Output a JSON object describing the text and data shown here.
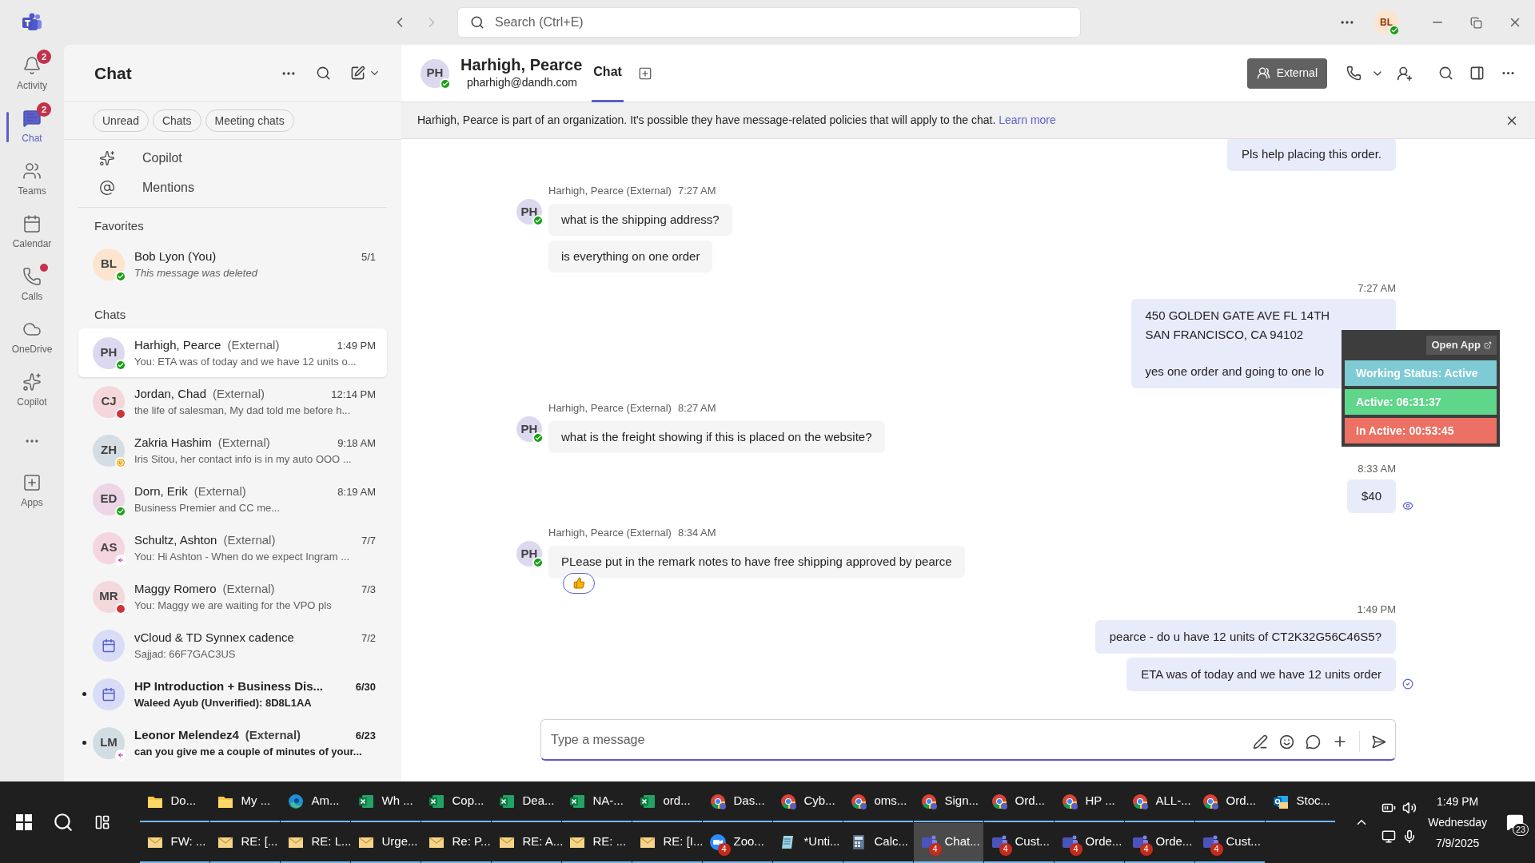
{
  "titlebar": {
    "search_placeholder": "Search (Ctrl+E)",
    "user_initials": "BL",
    "user_presence": {
      "kind": "available"
    }
  },
  "rail": [
    {
      "label": "Activity",
      "badge": "2",
      "alert": false,
      "selected": false
    },
    {
      "label": "Chat",
      "badge": "2",
      "alert": false,
      "selected": true
    },
    {
      "label": "Teams",
      "alert": false,
      "selected": false
    },
    {
      "label": "Calendar",
      "alert": false,
      "selected": false
    },
    {
      "label": "Calls",
      "alert": true,
      "selected": false
    },
    {
      "label": "OneDrive",
      "alert": false,
      "selected": false
    },
    {
      "label": "Copilot",
      "alert": false,
      "selected": false
    }
  ],
  "rail_apps": {
    "label": "Apps"
  },
  "chat_list": {
    "title": "Chat",
    "filters": [
      {
        "label": "Unread",
        "selected": false
      },
      {
        "label": "Chats",
        "selected": false
      },
      {
        "label": "Meeting chats",
        "selected": false
      }
    ],
    "shortcuts": [
      {
        "label": "Copilot"
      },
      {
        "label": "Mentions"
      }
    ],
    "sections": [
      {
        "heading": "Favorites",
        "items": [
          {
            "kind": "person",
            "initials": "BL",
            "color": "#fde4cf",
            "name": "Bob Lyon (You)",
            "time": "5/1",
            "preview": "This message was deleted",
            "deleted": true,
            "presence": {
              "kind": "available"
            },
            "selected": false,
            "unread": false
          }
        ]
      },
      {
        "heading": "Chats",
        "items": [
          {
            "kind": "person",
            "initials": "PH",
            "color": "#dcd8ef",
            "name": "Harhigh, Pearce",
            "tag": "(External)",
            "time": "1:49 PM",
            "preview": "You: ETA was of today and we have 12 units o...",
            "deleted": false,
            "presence": {
              "kind": "available"
            },
            "selected": true,
            "unread": false
          },
          {
            "kind": "person",
            "initials": "CJ",
            "color": "#f4d6db",
            "name": "Jordan, Chad",
            "tag": "(External)",
            "time": "12:14 PM",
            "preview": "the life of salesman, My dad told me before h...",
            "deleted": false,
            "presence": {
              "kind": "busy"
            },
            "selected": false,
            "unread": false
          },
          {
            "kind": "person",
            "initials": "ZH",
            "color": "#d4dde3",
            "name": "Zakria Hashim",
            "tag": "(External)",
            "time": "9:18 AM",
            "preview": "Iris Sitou, her contact info is in my auto OOO ...",
            "deleted": false,
            "presence": {
              "kind": "away"
            },
            "selected": false,
            "unread": false
          },
          {
            "kind": "person",
            "initials": "ED",
            "color": "#ecd5e4",
            "name": "Dorn, Erik",
            "tag": "(External)",
            "time": "8:19 AM",
            "preview": "Business Premier and CC me...",
            "deleted": false,
            "presence": {
              "kind": "available"
            },
            "selected": false,
            "unread": false
          },
          {
            "kind": "person",
            "initials": "AS",
            "color": "#f5d5e0",
            "name": "Schultz, Ashton",
            "tag": "(External)",
            "time": "7/7",
            "preview": "You: Hi Ashton -  When do we expect Ingram ...",
            "deleted": false,
            "presence": {
              "kind": "out"
            },
            "selected": false,
            "unread": false
          },
          {
            "kind": "person",
            "initials": "MR",
            "color": "#f3d8dc",
            "name": "Maggy Romero",
            "tag": "(External)",
            "time": "7/3",
            "preview": "You: Maggy we are waiting for the VPO pls",
            "deleted": false,
            "presence": {
              "kind": "busy"
            },
            "selected": false,
            "unread": false
          },
          {
            "kind": "meeting",
            "color": "#d9dcf7",
            "name": "vCloud & TD Synnex cadence",
            "time": "7/2",
            "preview": "Sajjad: 66F7GAC3US",
            "deleted": false,
            "selected": false,
            "unread": false
          },
          {
            "kind": "meeting",
            "color": "#d9dcf7",
            "name": "HP Introduction + Business Dis...",
            "time": "6/30",
            "preview": "Waleed Ayub (Unverified): 8D8L1AA",
            "deleted": false,
            "selected": false,
            "unread": true
          },
          {
            "kind": "person",
            "initials": "LM",
            "color": "#d2dde3",
            "name": "Leonor Melendez4",
            "tag": "(External)",
            "time": "6/23",
            "preview": "can you give me a couple of minutes of your...",
            "deleted": false,
            "presence": {
              "kind": "out"
            },
            "selected": false,
            "unread": true
          }
        ]
      }
    ]
  },
  "conversation": {
    "initials": "PH",
    "presence": {
      "kind": "available"
    },
    "name": "Harhigh, Pearce",
    "email": "pharhigh@dandh.com",
    "tabs": [
      {
        "label": "Chat",
        "selected": true
      }
    ],
    "external_button": "External",
    "banner": {
      "text": "Harhigh, Pearce is part of an organization. It's possible they have message-related policies that will apply to the chat.",
      "link": "Learn more"
    },
    "messages": [
      {
        "kind": "outgoing",
        "bubbles": [
          [
            [
              "Pls help placing this order."
            ]
          ]
        ]
      },
      {
        "kind": "incoming",
        "initials": "PH",
        "presence": {
          "kind": "available"
        },
        "sender": "Harhigh, Pearce (External)",
        "time": "7:27 AM",
        "bubbles": [
          [
            [
              "what is the shipping address?"
            ]
          ],
          [
            [
              "is everything on one order"
            ]
          ]
        ]
      },
      {
        "kind": "outgoing",
        "time": "7:27 AM",
        "bubbles": [
          [
            [
              "450 GOLDEN GATE AVE FL 14TH",
              "SAN FRANCISCO, CA 94102"
            ],
            [
              "yes one order and going to one lo"
            ]
          ]
        ]
      },
      {
        "kind": "incoming",
        "initials": "PH",
        "presence": {
          "kind": "available"
        },
        "sender": "Harhigh, Pearce (External)",
        "time": "8:27 AM",
        "bubbles": [
          [
            [
              "what is the freight showing if this is placed on the website?"
            ]
          ]
        ]
      },
      {
        "kind": "outgoing",
        "time": "8:33 AM",
        "bubbles": [
          [
            [
              "$40"
            ]
          ]
        ],
        "receipt": {
          "kind": "seen"
        }
      },
      {
        "kind": "incoming",
        "initials": "PH",
        "presence": {
          "kind": "available"
        },
        "sender": "Harhigh, Pearce (External)",
        "time": "8:34 AM",
        "bubbles": [
          [
            [
              "PLease put in the remark notes to have free shipping approved by pearce"
            ]
          ]
        ],
        "reaction": true
      },
      {
        "kind": "outgoing",
        "time": "1:49 PM",
        "bubbles": [
          [
            [
              "pearce -  do u have 12 units of CT2K32G56C46S5?"
            ]
          ],
          [
            [
              "ETA was of today and we have 12 units order"
            ]
          ]
        ],
        "receipt": {
          "kind": "sent"
        }
      }
    ],
    "composer": {
      "placeholder": "Type a message"
    }
  },
  "tracker": {
    "button": "Open App",
    "rows": [
      {
        "label": "Working Status: Active",
        "color": "#7ecbd6"
      },
      {
        "label": "Active: 06:31:37",
        "color": "#5fd68a"
      },
      {
        "label": "In Active: 00:53:45",
        "color": "#ec7063"
      }
    ]
  },
  "taskbar": {
    "rows": [
      [
        {
          "kind": "folder",
          "label": "Do...",
          "selected": false
        },
        {
          "kind": "folder",
          "label": "My ...",
          "selected": false
        },
        {
          "kind": "edge",
          "label": "Am...",
          "selected": false
        },
        {
          "kind": "excel",
          "label": "Wh ...",
          "selected": false
        },
        {
          "kind": "excel",
          "label": "Cop...",
          "selected": false
        },
        {
          "kind": "excel",
          "label": "Dea...",
          "selected": false
        },
        {
          "kind": "excel",
          "label": "NA-...",
          "selected": false
        },
        {
          "kind": "excel",
          "label": "ord...",
          "selected": false
        },
        {
          "kind": "chrome",
          "label": "Das...",
          "selected": false
        },
        {
          "kind": "chrome",
          "label": "Cyb...",
          "selected": false
        },
        {
          "kind": "chrome",
          "label": "oms...",
          "selected": false
        },
        {
          "kind": "chrome",
          "label": "Sign...",
          "selected": false
        },
        {
          "kind": "chrome",
          "label": "Ord...",
          "selected": false
        },
        {
          "kind": "chrome",
          "label": "HP ...",
          "selected": false
        },
        {
          "kind": "chrome",
          "label": "ALL-...",
          "selected": false
        },
        {
          "kind": "chrome",
          "label": "Ord...",
          "selected": false
        },
        {
          "kind": "outlook",
          "label": "Stoc...",
          "selected": false
        }
      ],
      [
        {
          "kind": "mail",
          "label": "FW: ...",
          "selected": false
        },
        {
          "kind": "mail",
          "label": "RE: [...",
          "selected": false
        },
        {
          "kind": "mail",
          "label": "RE: L...",
          "selected": false
        },
        {
          "kind": "mail",
          "label": "Urge...",
          "selected": false
        },
        {
          "kind": "mail",
          "label": "Re: P...",
          "selected": false
        },
        {
          "kind": "mail",
          "label": "RE: A...",
          "selected": false
        },
        {
          "kind": "mail",
          "label": "RE: ...",
          "selected": false
        },
        {
          "kind": "mail",
          "label": "RE: [I...",
          "selected": false
        },
        {
          "kind": "zoom",
          "label": "Zoo...",
          "badge": "4",
          "selected": false
        },
        {
          "kind": "notepad",
          "label": "*Unti...",
          "selected": false
        },
        {
          "kind": "calc",
          "label": "Calc...",
          "selected": false
        },
        {
          "kind": "teams",
          "label": "Chat...",
          "badge": "4",
          "selected": true
        },
        {
          "kind": "teams",
          "label": "Cust...",
          "badge": "4",
          "selected": false
        },
        {
          "kind": "teams",
          "label": "Orde...",
          "badge": "4",
          "selected": false
        },
        {
          "kind": "teams",
          "label": "Orde...",
          "badge": "4",
          "selected": false
        },
        {
          "kind": "teams",
          "label": "Cust...",
          "badge": "4",
          "selected": false
        }
      ]
    ],
    "time": "1:49 PM",
    "day": "Wednesday",
    "date": "7/9/2025",
    "notifications": "23"
  }
}
